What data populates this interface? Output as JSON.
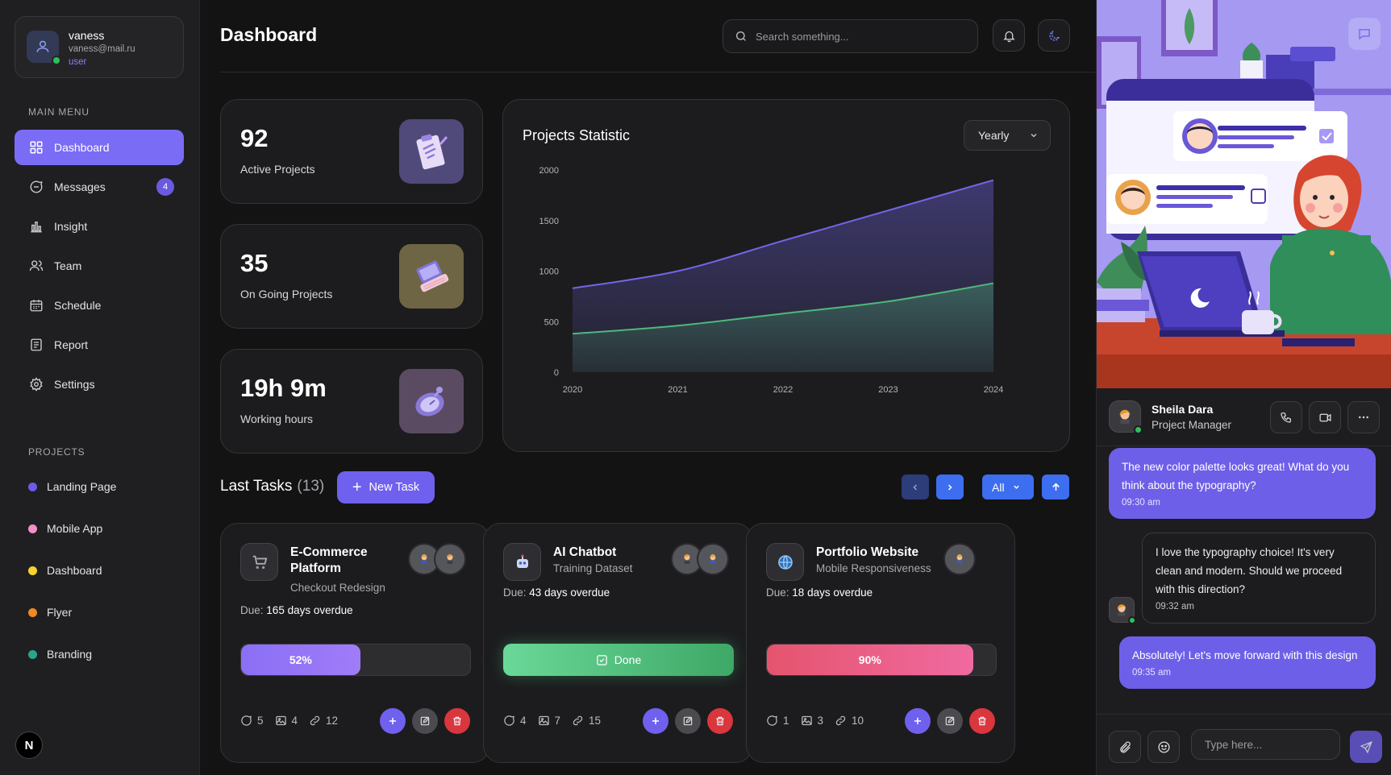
{
  "user": {
    "name": "vaness",
    "email": "vaness@mail.ru",
    "role": "user"
  },
  "sidebar": {
    "main_menu_label": "MAIN MENU",
    "items": [
      {
        "label": "Dashboard",
        "icon": "grid-icon",
        "active": true
      },
      {
        "label": "Messages",
        "icon": "message-icon",
        "badge": "4"
      },
      {
        "label": "Insight",
        "icon": "bar-chart-icon"
      },
      {
        "label": "Team",
        "icon": "team-icon"
      },
      {
        "label": "Schedule",
        "icon": "calendar-icon"
      },
      {
        "label": "Report",
        "icon": "report-icon"
      },
      {
        "label": "Settings",
        "icon": "gear-icon"
      }
    ],
    "projects_label": "PROJECTS",
    "projects": [
      {
        "label": "Landing Page",
        "color": "#6c5ce7"
      },
      {
        "label": "Mobile App",
        "color": "#f48fc7"
      },
      {
        "label": "Dashboard",
        "color": "#f6d32d"
      },
      {
        "label": "Flyer",
        "color": "#f08a24"
      },
      {
        "label": "Branding",
        "color": "#2aa58c"
      }
    ],
    "logo_letter": "N"
  },
  "header": {
    "title": "Dashboard",
    "search_placeholder": "Search something..."
  },
  "stats": [
    {
      "value": "92",
      "label": "Active Projects",
      "icon": "clipboard-icon"
    },
    {
      "value": "35",
      "label": "On Going Projects",
      "icon": "laptop-icon"
    },
    {
      "value": "19h 9m",
      "label": "Working hours",
      "icon": "stopwatch-icon"
    }
  ],
  "chart_panel": {
    "title": "Projects Statistic",
    "period": "Yearly"
  },
  "chart_data": {
    "type": "area",
    "x": [
      "2020",
      "2021",
      "2022",
      "2023",
      "2024"
    ],
    "ylim": [
      0,
      2000
    ],
    "yticks": [
      "0",
      "500",
      "1000",
      "1500",
      "2000"
    ],
    "grid": false,
    "series": [
      {
        "values": [
          830,
          1000,
          1300,
          1600,
          1900
        ],
        "color": "#7266e8"
      },
      {
        "values": [
          380,
          460,
          580,
          700,
          880
        ],
        "color": "#4fb87a"
      }
    ]
  },
  "tasks": {
    "title": "Last Tasks",
    "count": "(13)",
    "new_task_label": "New Task",
    "filter_label": "All",
    "items": [
      {
        "icon": "cart-icon",
        "name": "E-Commerce Platform",
        "subtitle": "Checkout Redesign",
        "due_label": "Due:",
        "due": "165 days overdue",
        "progress": 52,
        "progress_text": "52%",
        "comments": "5",
        "images": "4",
        "links": "12"
      },
      {
        "icon": "robot-icon",
        "name": "AI Chatbot",
        "subtitle": "Training Dataset",
        "due_label": "Due:",
        "due": "43 days overdue",
        "status": "Done",
        "comments": "4",
        "images": "7",
        "links": "15"
      },
      {
        "icon": "globe-icon",
        "name": "Portfolio Website",
        "subtitle": "Mobile Responsiveness",
        "due_label": "Due:",
        "due": "18 days overdue",
        "progress": 90,
        "progress_text": "90%",
        "comments": "1",
        "images": "3",
        "links": "10"
      }
    ]
  },
  "chat": {
    "contact_name": "Sheila Dara",
    "contact_role": "Project Manager",
    "messages": [
      {
        "from": "me",
        "text": "The new color palette looks great! What do you think about the typography?",
        "time": "09:30 am"
      },
      {
        "from": "them",
        "text": "I love the typography choice! It's very clean and modern. Should we proceed with this direction?",
        "time": "09:32 am"
      },
      {
        "from": "me",
        "text": "Absolutely! Let's move forward with this design",
        "time": "09:35 am"
      }
    ],
    "input_placeholder": "Type here..."
  }
}
